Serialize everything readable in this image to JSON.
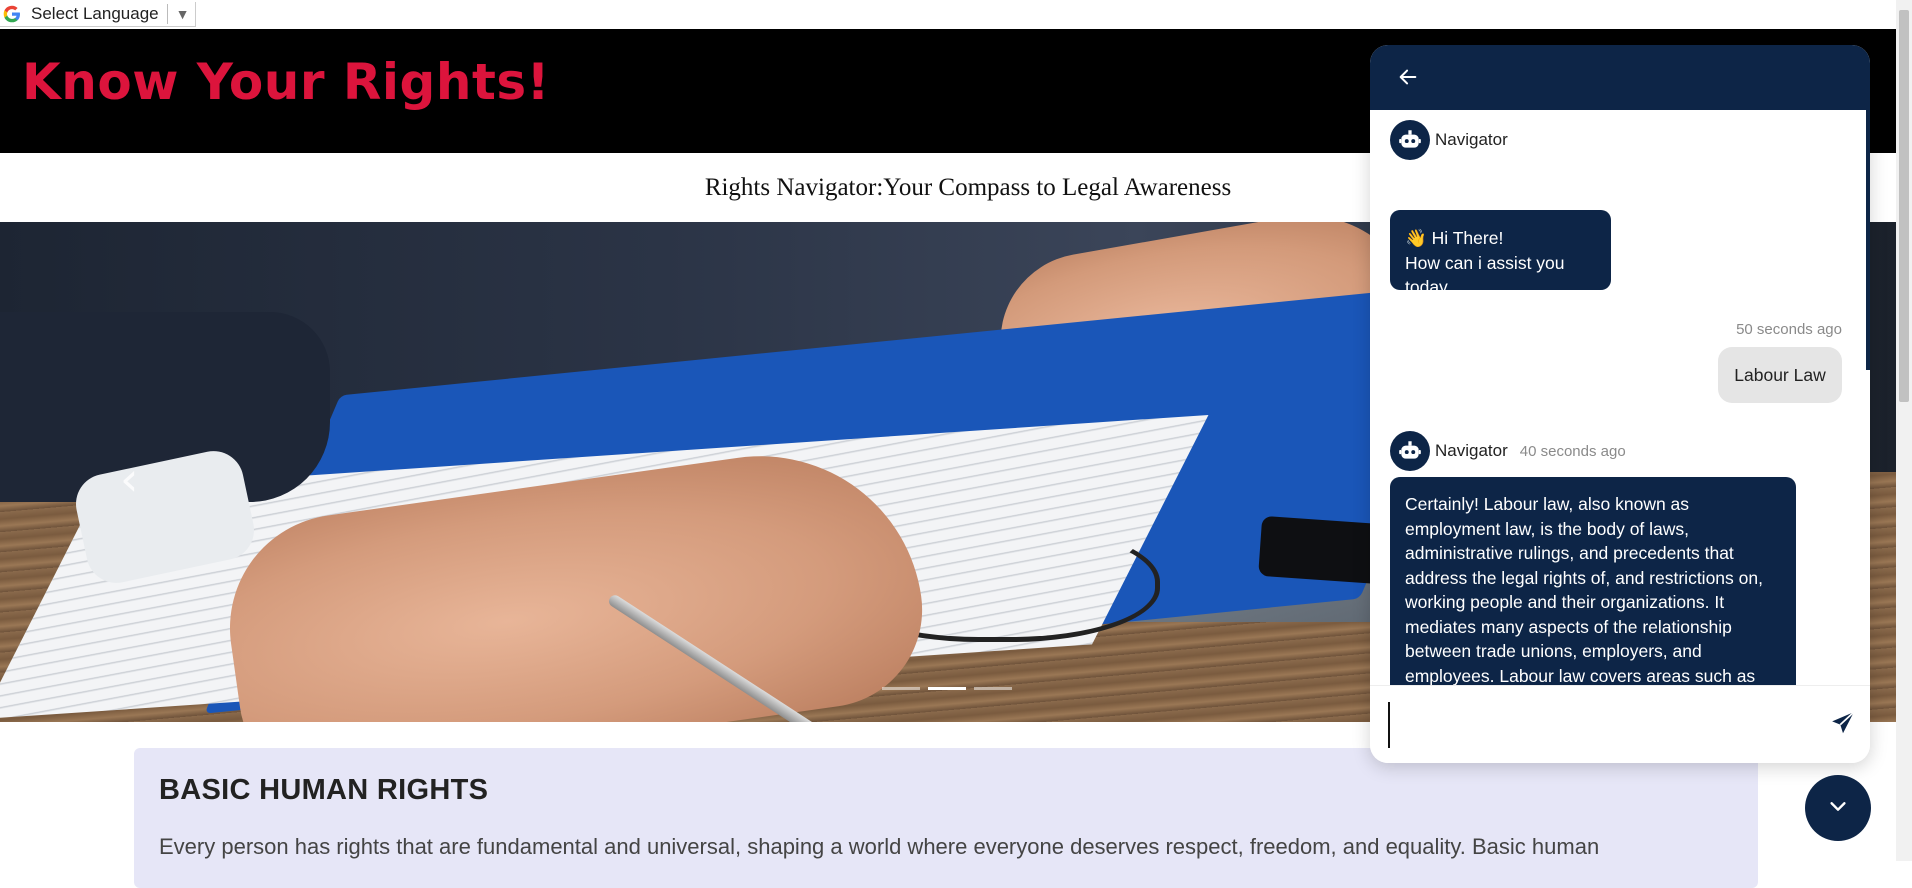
{
  "translate": {
    "label": "Select Language",
    "caret": "▼",
    "icon": "google-g-icon"
  },
  "header": {
    "title": "Know Your Rights!",
    "title_color": "#dc143c",
    "subtitle": "Rights Navigator:Your Compass to Legal Awareness"
  },
  "carousel": {
    "prev_icon": "‹",
    "slides": 3,
    "active_slide": 2
  },
  "rights": {
    "title": "BASIC HUMAN RIGHTS",
    "body": "Every person has rights that are fundamental and universal, shaping a world where everyone deserves respect, freedom, and equality. Basic human"
  },
  "chat": {
    "accent": "#0d2547",
    "back_icon": "arrow-left-icon",
    "messages": [
      {
        "sender": "Navigator",
        "time": "",
        "line1": "👋 Hi There!",
        "line2": "How can i assist you today"
      },
      {
        "sender": "user",
        "time": "50 seconds ago",
        "text": "Labour Law"
      },
      {
        "sender": "Navigator",
        "time": "40 seconds ago",
        "text": "Certainly! Labour law, also known as employment law, is the body of laws, administrative rulings, and precedents that address the legal rights of, and restrictions on, working people and their organizations. It mediates many aspects of the relationship between trade unions, employers, and employees. Labour law covers areas such as industrial relations, workplace health and safety, and employment standards, including"
      }
    ],
    "input": {
      "value": "",
      "placeholder": ""
    },
    "send_icon": "send-icon",
    "toggle_icon": "chevron-down-icon"
  }
}
